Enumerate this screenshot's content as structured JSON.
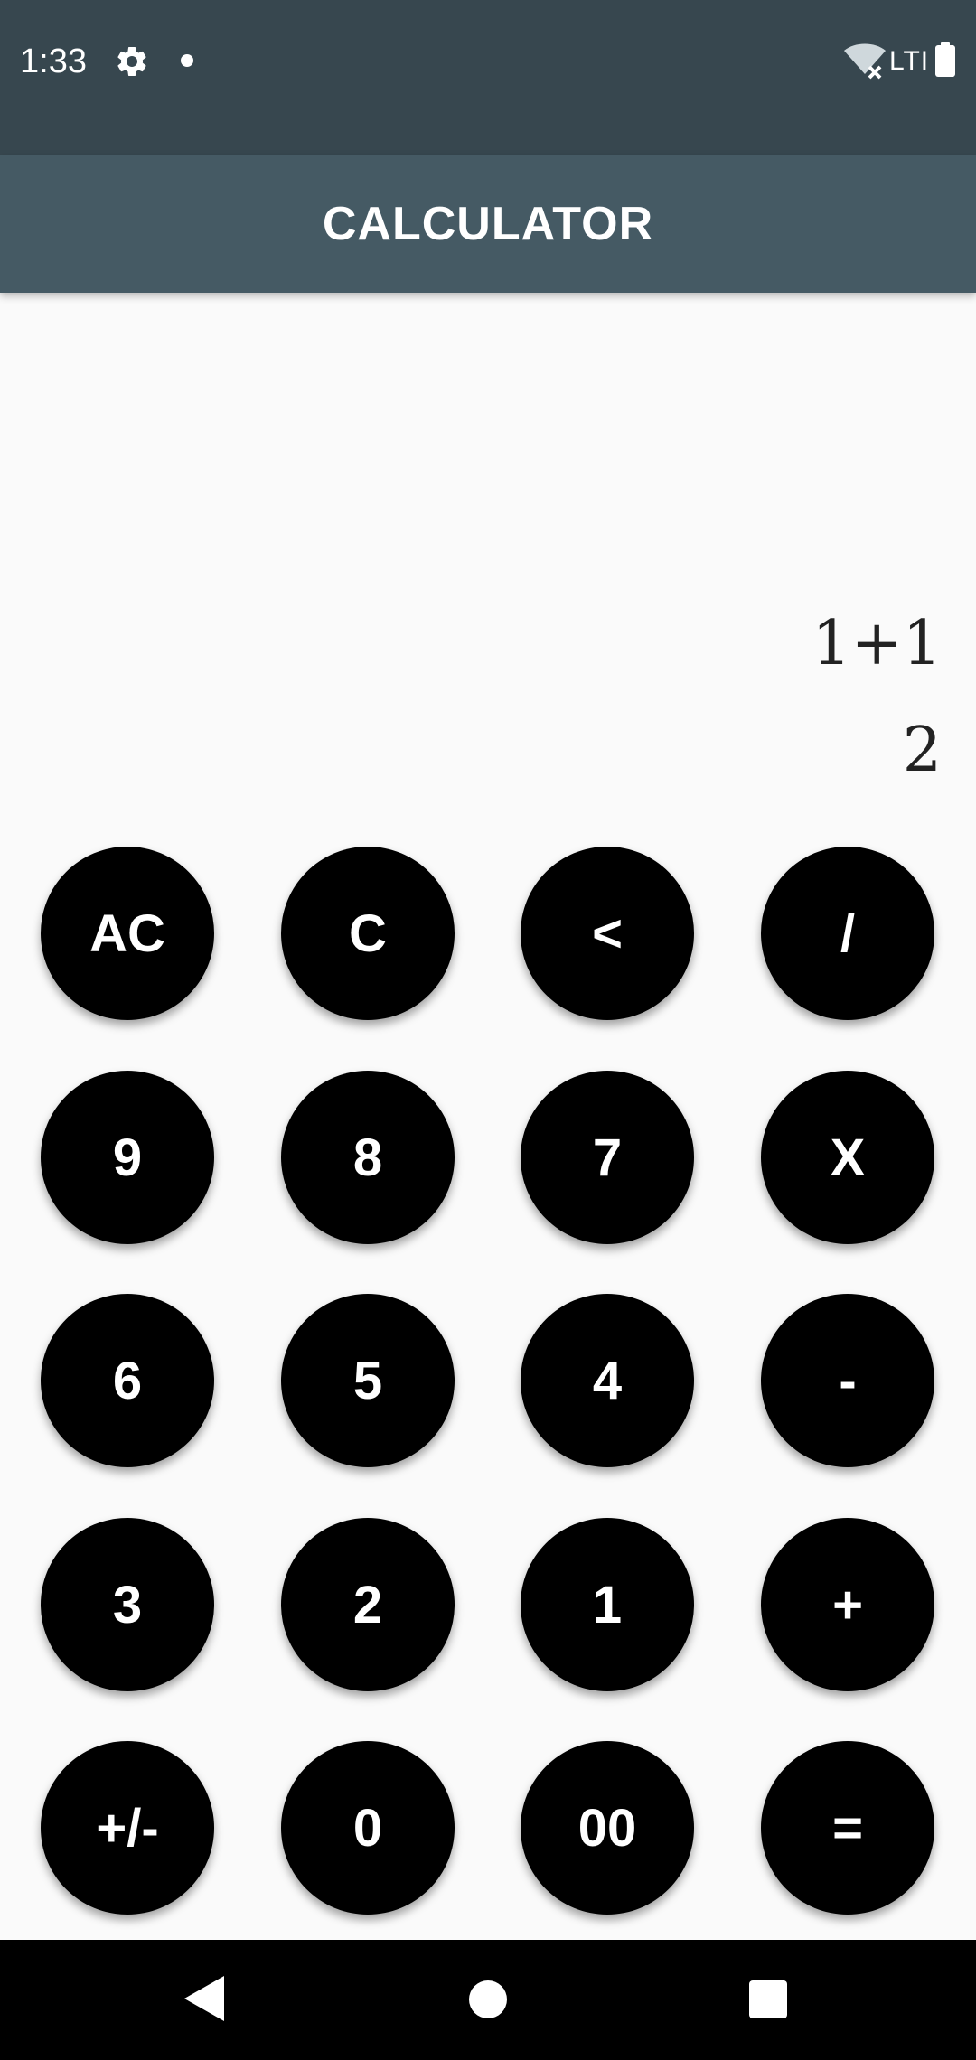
{
  "status_bar": {
    "time": "1:33",
    "network": "LTI",
    "icons": [
      "gear-icon",
      "notification-dot-icon",
      "wifi-off-icon",
      "battery-icon"
    ]
  },
  "app_bar": {
    "title": "CALCULATOR"
  },
  "display": {
    "expression": "1+1",
    "result": "2"
  },
  "keypad": {
    "rows": [
      [
        "AC",
        "C",
        "<",
        "/"
      ],
      [
        "9",
        "8",
        "7",
        "X"
      ],
      [
        "6",
        "5",
        "4",
        "-"
      ],
      [
        "3",
        "2",
        "1",
        "+"
      ],
      [
        "+/-",
        "0",
        "00",
        "="
      ]
    ]
  },
  "nav_bar": {
    "icons": [
      "back-icon",
      "home-icon",
      "recents-icon"
    ]
  },
  "colors": {
    "status_bar": "#37474f",
    "app_bar": "#455a64",
    "background": "#fafafa",
    "key": "#000000",
    "key_text": "#ffffff"
  }
}
